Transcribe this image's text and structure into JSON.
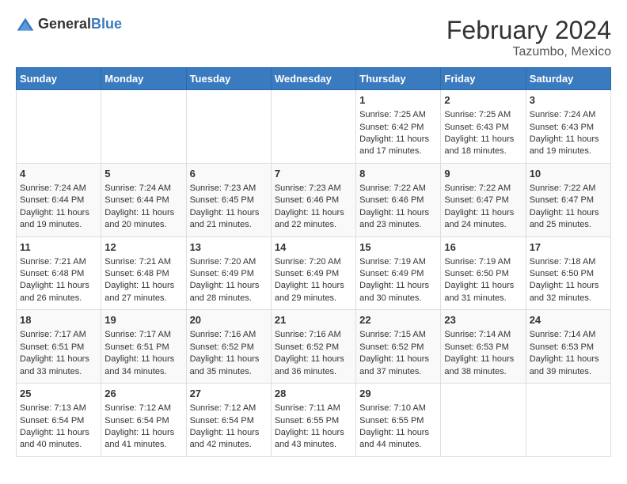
{
  "logo": {
    "general": "General",
    "blue": "Blue"
  },
  "title": {
    "month_year": "February 2024",
    "location": "Tazumbo, Mexico"
  },
  "weekdays": [
    "Sunday",
    "Monday",
    "Tuesday",
    "Wednesday",
    "Thursday",
    "Friday",
    "Saturday"
  ],
  "weeks": [
    [
      {
        "day": "",
        "info": ""
      },
      {
        "day": "",
        "info": ""
      },
      {
        "day": "",
        "info": ""
      },
      {
        "day": "",
        "info": ""
      },
      {
        "day": "1",
        "info": "Sunrise: 7:25 AM\nSunset: 6:42 PM\nDaylight: 11 hours and 17 minutes."
      },
      {
        "day": "2",
        "info": "Sunrise: 7:25 AM\nSunset: 6:43 PM\nDaylight: 11 hours and 18 minutes."
      },
      {
        "day": "3",
        "info": "Sunrise: 7:24 AM\nSunset: 6:43 PM\nDaylight: 11 hours and 19 minutes."
      }
    ],
    [
      {
        "day": "4",
        "info": "Sunrise: 7:24 AM\nSunset: 6:44 PM\nDaylight: 11 hours and 19 minutes."
      },
      {
        "day": "5",
        "info": "Sunrise: 7:24 AM\nSunset: 6:44 PM\nDaylight: 11 hours and 20 minutes."
      },
      {
        "day": "6",
        "info": "Sunrise: 7:23 AM\nSunset: 6:45 PM\nDaylight: 11 hours and 21 minutes."
      },
      {
        "day": "7",
        "info": "Sunrise: 7:23 AM\nSunset: 6:46 PM\nDaylight: 11 hours and 22 minutes."
      },
      {
        "day": "8",
        "info": "Sunrise: 7:22 AM\nSunset: 6:46 PM\nDaylight: 11 hours and 23 minutes."
      },
      {
        "day": "9",
        "info": "Sunrise: 7:22 AM\nSunset: 6:47 PM\nDaylight: 11 hours and 24 minutes."
      },
      {
        "day": "10",
        "info": "Sunrise: 7:22 AM\nSunset: 6:47 PM\nDaylight: 11 hours and 25 minutes."
      }
    ],
    [
      {
        "day": "11",
        "info": "Sunrise: 7:21 AM\nSunset: 6:48 PM\nDaylight: 11 hours and 26 minutes."
      },
      {
        "day": "12",
        "info": "Sunrise: 7:21 AM\nSunset: 6:48 PM\nDaylight: 11 hours and 27 minutes."
      },
      {
        "day": "13",
        "info": "Sunrise: 7:20 AM\nSunset: 6:49 PM\nDaylight: 11 hours and 28 minutes."
      },
      {
        "day": "14",
        "info": "Sunrise: 7:20 AM\nSunset: 6:49 PM\nDaylight: 11 hours and 29 minutes."
      },
      {
        "day": "15",
        "info": "Sunrise: 7:19 AM\nSunset: 6:49 PM\nDaylight: 11 hours and 30 minutes."
      },
      {
        "day": "16",
        "info": "Sunrise: 7:19 AM\nSunset: 6:50 PM\nDaylight: 11 hours and 31 minutes."
      },
      {
        "day": "17",
        "info": "Sunrise: 7:18 AM\nSunset: 6:50 PM\nDaylight: 11 hours and 32 minutes."
      }
    ],
    [
      {
        "day": "18",
        "info": "Sunrise: 7:17 AM\nSunset: 6:51 PM\nDaylight: 11 hours and 33 minutes."
      },
      {
        "day": "19",
        "info": "Sunrise: 7:17 AM\nSunset: 6:51 PM\nDaylight: 11 hours and 34 minutes."
      },
      {
        "day": "20",
        "info": "Sunrise: 7:16 AM\nSunset: 6:52 PM\nDaylight: 11 hours and 35 minutes."
      },
      {
        "day": "21",
        "info": "Sunrise: 7:16 AM\nSunset: 6:52 PM\nDaylight: 11 hours and 36 minutes."
      },
      {
        "day": "22",
        "info": "Sunrise: 7:15 AM\nSunset: 6:52 PM\nDaylight: 11 hours and 37 minutes."
      },
      {
        "day": "23",
        "info": "Sunrise: 7:14 AM\nSunset: 6:53 PM\nDaylight: 11 hours and 38 minutes."
      },
      {
        "day": "24",
        "info": "Sunrise: 7:14 AM\nSunset: 6:53 PM\nDaylight: 11 hours and 39 minutes."
      }
    ],
    [
      {
        "day": "25",
        "info": "Sunrise: 7:13 AM\nSunset: 6:54 PM\nDaylight: 11 hours and 40 minutes."
      },
      {
        "day": "26",
        "info": "Sunrise: 7:12 AM\nSunset: 6:54 PM\nDaylight: 11 hours and 41 minutes."
      },
      {
        "day": "27",
        "info": "Sunrise: 7:12 AM\nSunset: 6:54 PM\nDaylight: 11 hours and 42 minutes."
      },
      {
        "day": "28",
        "info": "Sunrise: 7:11 AM\nSunset: 6:55 PM\nDaylight: 11 hours and 43 minutes."
      },
      {
        "day": "29",
        "info": "Sunrise: 7:10 AM\nSunset: 6:55 PM\nDaylight: 11 hours and 44 minutes."
      },
      {
        "day": "",
        "info": ""
      },
      {
        "day": "",
        "info": ""
      }
    ]
  ]
}
